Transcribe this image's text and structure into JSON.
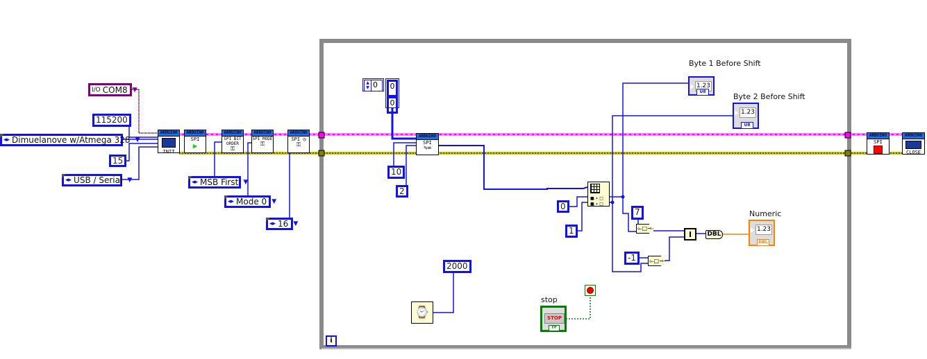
{
  "colors": {
    "numeric_wire": "#1010f0",
    "visa_wire": "#ff00ff",
    "error_wire": "#c8c800",
    "double_wire": "#ff8000",
    "bool_wire": "#008000",
    "loop_border": "#888888",
    "visa_resource": "#800080"
  },
  "init_inputs": {
    "visa_resource": "COM8",
    "baud_rate": "115200",
    "board_type": "Dimuelanove w/Atmega 328",
    "bytes_per_packet": "15",
    "connection_type": "USB / Serial"
  },
  "vis": {
    "vendor": "ARDUINO",
    "init": "INIT",
    "spi_open": "SPI",
    "spi_bit_order": "SPI BIT ORDER",
    "spi_mode": "SPI MODE",
    "spi_clock": "SPI",
    "spi_read_write": "SPI",
    "spi_close": "SPI",
    "close": "CLOSE"
  },
  "spi_config": {
    "bit_order": "MSB First",
    "mode": "Mode 0",
    "clock_divider": "16"
  },
  "loop": {
    "array_index": "0",
    "array_values": [
      "0",
      "0"
    ],
    "cs_pin": "10",
    "bytes_to_read": "2",
    "index_0": "0",
    "index_1": "1",
    "shift_amount": "7",
    "shift_amount_2": "-1",
    "convert_label": "DBL",
    "wait_ms": "2000",
    "iteration_terminal": "i"
  },
  "indicators": {
    "byte1": {
      "label": "Byte 1 Before Shift",
      "display": "1.23",
      "type": "U8"
    },
    "byte2": {
      "label": "Byte 2 Before Shift",
      "display": "1.23",
      "type": "U8"
    },
    "numeric": {
      "label": "Numeric",
      "display": "1.23",
      "type": "DBL"
    }
  },
  "stop": {
    "label": "stop",
    "button_text": "STOP",
    "type": "TF"
  }
}
